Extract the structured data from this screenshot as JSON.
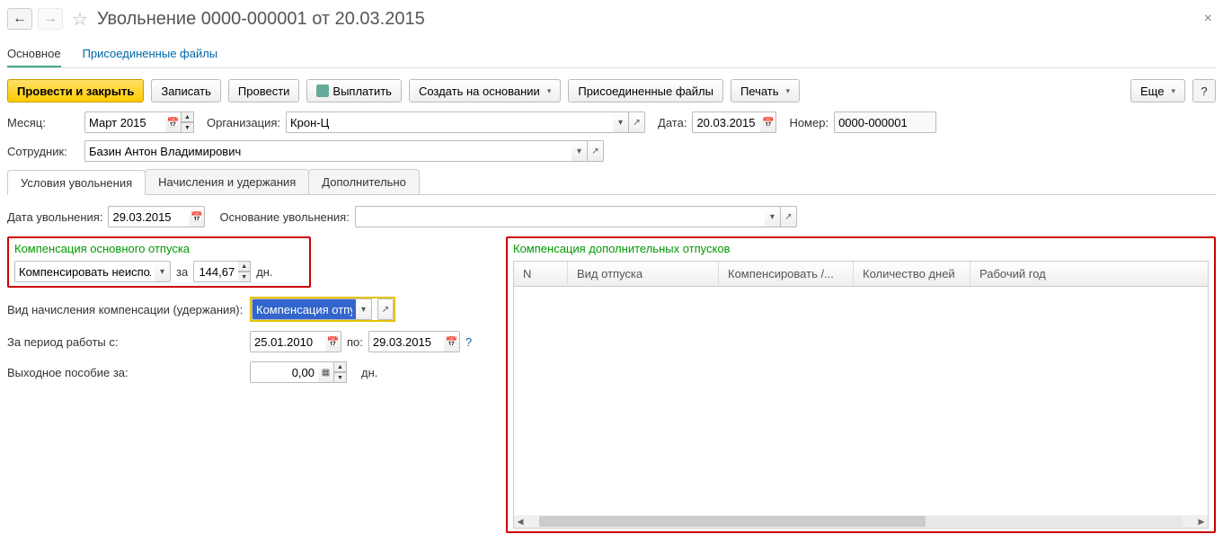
{
  "header": {
    "title": "Увольнение 0000-000001 от 20.03.2015"
  },
  "navtabs": {
    "main": "Основное",
    "files": "Присоединенные файлы"
  },
  "toolbar": {
    "post_close": "Провести и закрыть",
    "save": "Записать",
    "post": "Провести",
    "pay": "Выплатить",
    "create_based": "Создать на основании",
    "attached": "Присоединенные файлы",
    "print": "Печать",
    "more": "Еще",
    "help": "?"
  },
  "row1": {
    "month_label": "Месяц:",
    "month_value": "Март 2015",
    "org_label": "Организация:",
    "org_value": "Крон-Ц",
    "date_label": "Дата:",
    "date_value": "20.03.2015",
    "num_label": "Номер:",
    "num_value": "0000-000001"
  },
  "row2": {
    "emp_label": "Сотрудник:",
    "emp_value": "Базин Антон Владимирович"
  },
  "subtabs": {
    "t1": "Условия увольнения",
    "t2": "Начисления и удержания",
    "t3": "Дополнительно"
  },
  "left": {
    "dismiss_date_label": "Дата увольнения:",
    "dismiss_date_value": "29.03.2015",
    "reason_label": "Основание увольнения:",
    "comp_main_title": "Компенсация основного отпуска",
    "comp_mode": "Компенсировать неиспол",
    "za": "за",
    "days_value": "144,67",
    "dn": "дн.",
    "accrual_type_label": "Вид начисления компенсации (удержания):",
    "accrual_type_value": "Компенсация отпу",
    "period_label": "За период работы с:",
    "period_from": "25.01.2010",
    "po": "по:",
    "period_to": "29.03.2015",
    "severance_label": "Выходное пособие за:",
    "severance_value": "0,00"
  },
  "right": {
    "title": "Компенсация дополнительных отпусков",
    "cols": {
      "n": "N",
      "type": "Вид отпуска",
      "comp": "Компенсировать /...",
      "days": "Количество дней",
      "year": "Рабочий год"
    }
  }
}
